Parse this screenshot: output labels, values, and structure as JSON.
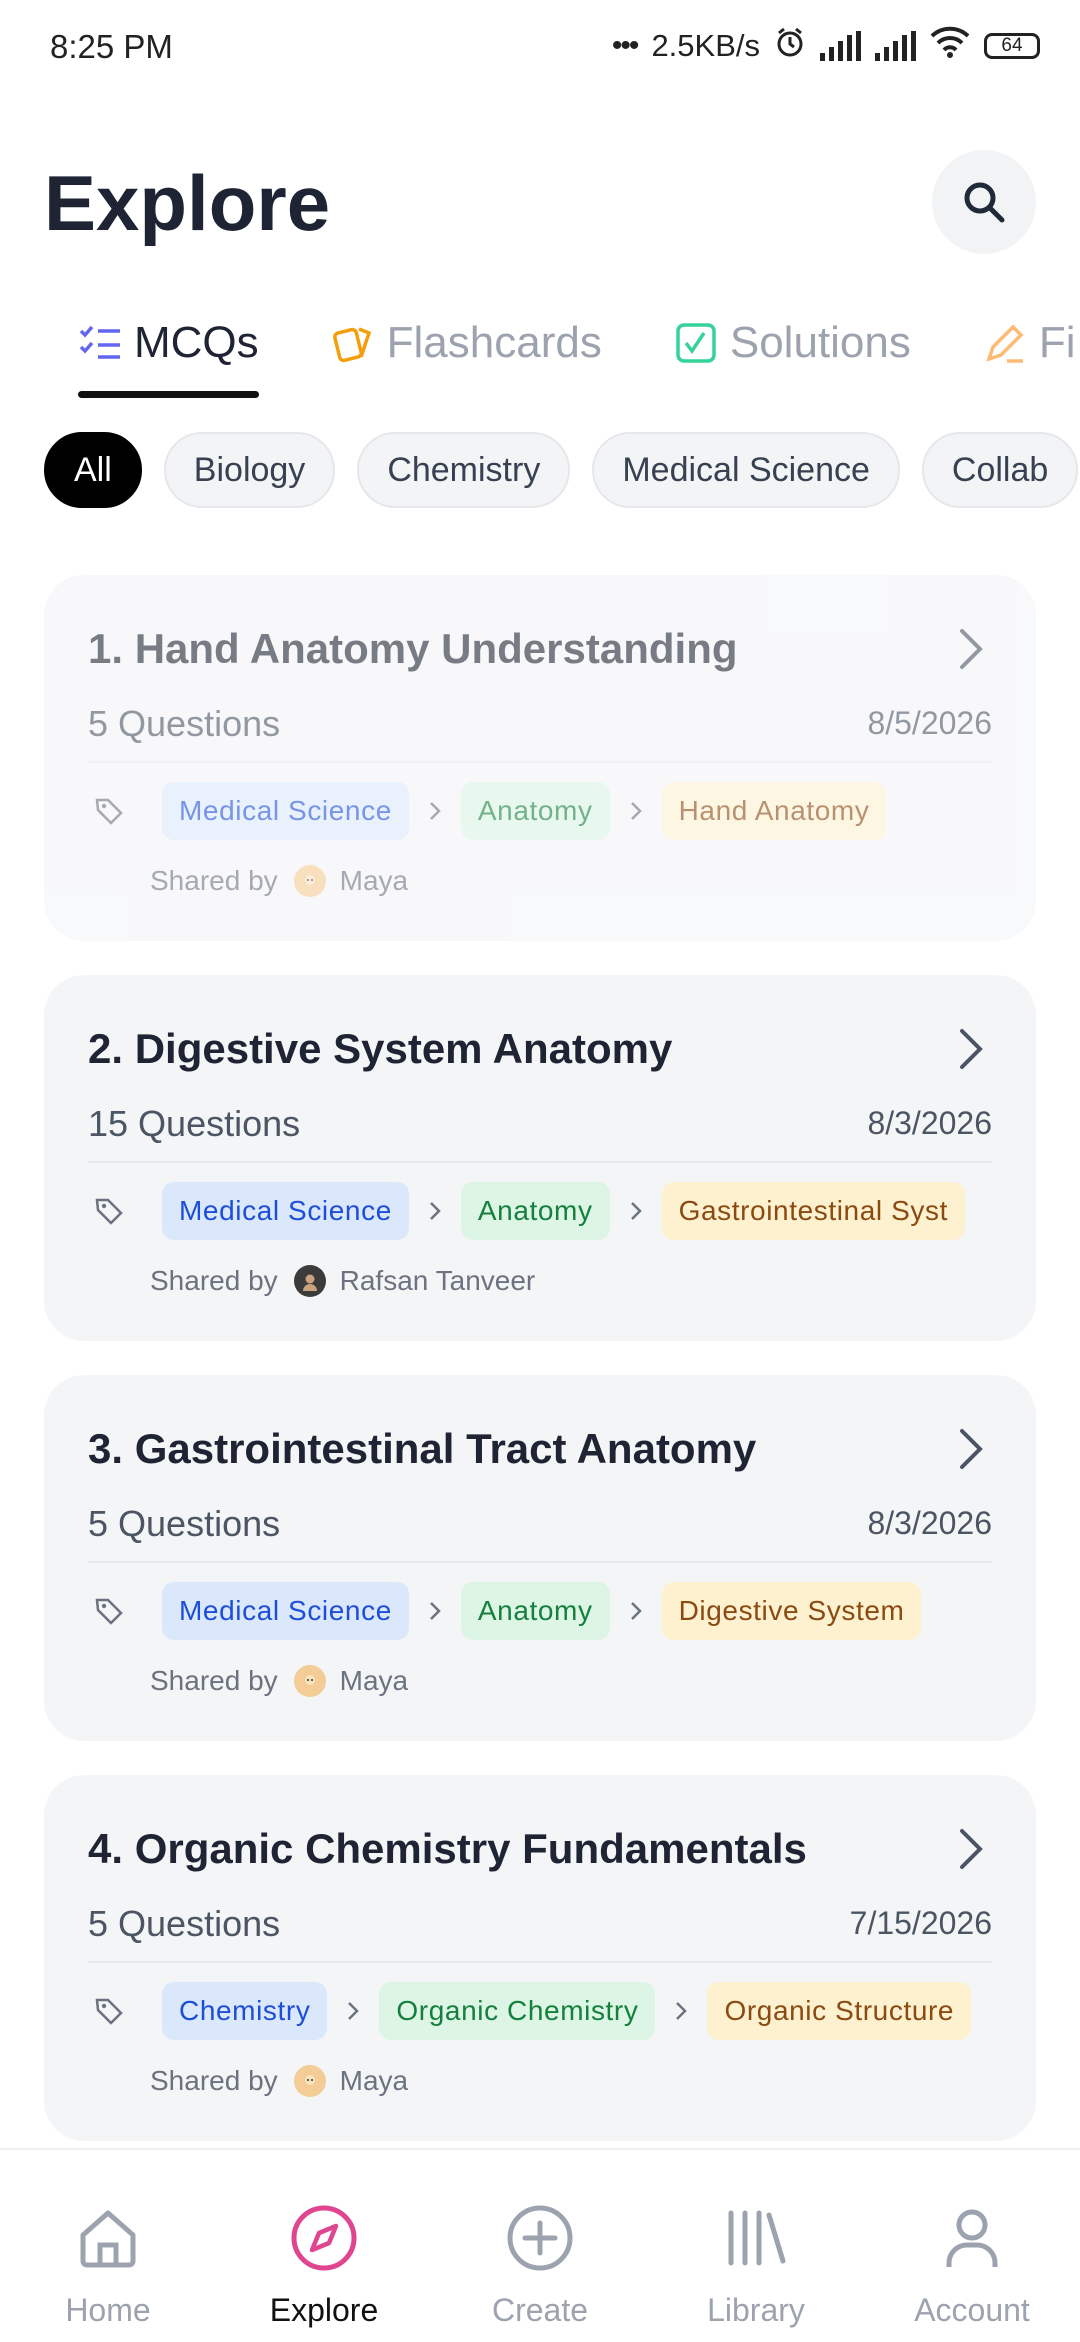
{
  "status_bar": {
    "time": "8:25 PM",
    "network_speed": "2.5KB/s",
    "battery": "64"
  },
  "header": {
    "title": "Explore"
  },
  "tabs": [
    {
      "label": "MCQs",
      "icon": "checklist-icon",
      "active": true
    },
    {
      "label": "Flashcards",
      "icon": "flashcards-icon",
      "active": false
    },
    {
      "label": "Solutions",
      "icon": "solutions-icon",
      "active": false
    },
    {
      "label": "Fi",
      "icon": "pencil-icon",
      "active": false
    }
  ],
  "filters": [
    {
      "label": "All",
      "active": true
    },
    {
      "label": "Biology",
      "active": false
    },
    {
      "label": "Chemistry",
      "active": false
    },
    {
      "label": "Medical Science",
      "active": false
    },
    {
      "label": "Collab",
      "active": false
    }
  ],
  "shared_by_label": "Shared by",
  "cards": [
    {
      "title": "1. Hand Anatomy Understanding",
      "questions": "5 Questions",
      "date": "8/5/2026",
      "tags": [
        "Medical Science",
        "Anatomy",
        "Hand Anatomy"
      ],
      "author": "Maya"
    },
    {
      "title": "2. Digestive System Anatomy",
      "questions": "15 Questions",
      "date": "8/3/2026",
      "tags": [
        "Medical Science",
        "Anatomy",
        "Gastrointestinal Syst"
      ],
      "author": "Rafsan Tanveer"
    },
    {
      "title": "3. Gastrointestinal Tract Anatomy",
      "questions": "5 Questions",
      "date": "8/3/2026",
      "tags": [
        "Medical Science",
        "Anatomy",
        "Digestive System"
      ],
      "author": "Maya"
    },
    {
      "title": "4. Organic Chemistry Fundamentals",
      "questions": "5 Questions",
      "date": "7/15/2026",
      "tags": [
        "Chemistry",
        "Organic Chemistry",
        "Organic Structure"
      ],
      "author": "Maya"
    }
  ],
  "bottom_nav": [
    {
      "label": "Home",
      "icon": "home-icon",
      "active": false
    },
    {
      "label": "Explore",
      "icon": "compass-icon",
      "active": true
    },
    {
      "label": "Create",
      "icon": "plus-circle-icon",
      "active": false
    },
    {
      "label": "Library",
      "icon": "library-icon",
      "active": false
    },
    {
      "label": "Account",
      "icon": "user-icon",
      "active": false
    }
  ],
  "colors": {
    "accent": "#e0458f",
    "tag_blue": "#1d4ed8",
    "tag_green": "#15803d",
    "tag_yellow": "#8a4a12"
  }
}
